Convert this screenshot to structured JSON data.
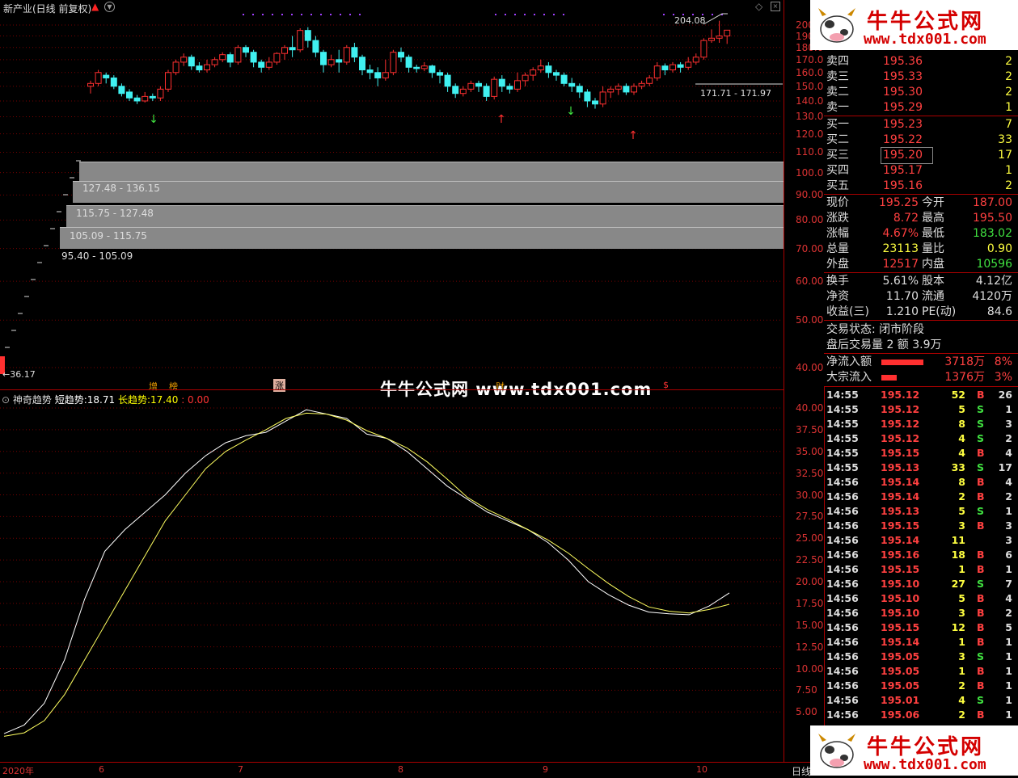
{
  "main_title": "新产业(日线 前复权)",
  "indicator": {
    "name": "神奇趋势",
    "short_label": "短趋势:",
    "short_value": "18.71",
    "long_label": "长趋势:",
    "long_value": "17.40",
    "extra_value": ": 0.00"
  },
  "watermark": "牛牛公式网 www.tdx001.com",
  "logo": {
    "title": "牛牛公式网",
    "url": "www.tdx001.com"
  },
  "markers": {
    "zeng": "增",
    "bang": "榜",
    "zhang": "涨",
    "cai": "财",
    "dollar": "$"
  },
  "annotations": {
    "high": "204.08",
    "low": "36.17",
    "box": "171.71 - 171.97"
  },
  "price_bands": [
    {
      "label": "127.48 - 136.15"
    },
    {
      "label": "115.75 - 127.48"
    },
    {
      "label": "105.09 - 115.75"
    },
    {
      "label": "95.40 - 105.09"
    }
  ],
  "date_axis": {
    "year": "2020年",
    "months": [
      "6",
      "7",
      "8",
      "9",
      "10"
    ],
    "period": "日线"
  },
  "price_axis_labels": [
    "200",
    "190",
    "180.0",
    "170.0",
    "160.0",
    "150.0",
    "140.0",
    "130.0",
    "120.0",
    "110.0",
    "100.0",
    "90.00",
    "80.00",
    "70.00",
    "60.00",
    "50.00",
    "40.00"
  ],
  "ind_axis_labels": [
    "40.00",
    "37.50",
    "35.00",
    "32.50",
    "30.00",
    "27.50",
    "25.00",
    "22.50",
    "20.00",
    "17.50",
    "15.00",
    "12.50",
    "10.00",
    "7.50",
    "5.00"
  ],
  "order_book": {
    "asks": [
      {
        "label": "卖四",
        "price": "195.36",
        "vol": "2"
      },
      {
        "label": "卖三",
        "price": "195.33",
        "vol": "2"
      },
      {
        "label": "卖二",
        "price": "195.30",
        "vol": "2"
      },
      {
        "label": "卖一",
        "price": "195.29",
        "vol": "1"
      }
    ],
    "bids": [
      {
        "label": "买一",
        "price": "195.23",
        "vol": "7"
      },
      {
        "label": "买二",
        "price": "195.22",
        "vol": "33"
      },
      {
        "label": "买三",
        "price": "195.20",
        "vol": "17"
      },
      {
        "label": "买四",
        "price": "195.17",
        "vol": "1"
      },
      {
        "label": "买五",
        "price": "195.16",
        "vol": "2"
      }
    ]
  },
  "quote": [
    {
      "l1": "现价",
      "v1": "195.25",
      "l2": "今开",
      "v2": "187.00",
      "c1": "#ff4040",
      "c2": "#ff4040"
    },
    {
      "l1": "涨跌",
      "v1": "8.72",
      "l2": "最高",
      "v2": "195.50",
      "c1": "#ff4040",
      "c2": "#ff4040"
    },
    {
      "l1": "涨幅",
      "v1": "4.67%",
      "l2": "最低",
      "v2": "183.02",
      "c1": "#ff4040",
      "c2": "#40e040"
    },
    {
      "l1": "总量",
      "v1": "23113",
      "l2": "量比",
      "v2": "0.90",
      "c1": "#ffff40",
      "c2": "#ffff40"
    },
    {
      "l1": "外盘",
      "v1": "12517",
      "l2": "内盘",
      "v2": "10596",
      "c1": "#ff4040",
      "c2": "#40e040"
    }
  ],
  "fundamentals": [
    {
      "l1": "换手",
      "v1": "5.61%",
      "l2": "股本",
      "v2": "4.12亿"
    },
    {
      "l1": "净资",
      "v1": "11.70",
      "l2": "流通",
      "v2": "4120万"
    },
    {
      "l1": "收益(三)",
      "v1": "1.210",
      "l2": "PE(动)",
      "v2": "84.6"
    }
  ],
  "status": {
    "line1": "交易状态: 闭市阶段",
    "line2": "盘后交易量 2 额 3.9万"
  },
  "flows": [
    {
      "label": "净流入额",
      "value": "3718万",
      "pct": "8%",
      "bar": 0.95
    },
    {
      "label": "大宗流入",
      "value": "1376万",
      "pct": "3%",
      "bar": 0.35
    }
  ],
  "ticks": [
    {
      "t": "14:55",
      "p": "195.12",
      "v": "52",
      "s": "B",
      "n": "26"
    },
    {
      "t": "14:55",
      "p": "195.12",
      "v": "5",
      "s": "S",
      "n": "1"
    },
    {
      "t": "14:55",
      "p": "195.12",
      "v": "8",
      "s": "S",
      "n": "3"
    },
    {
      "t": "14:55",
      "p": "195.12",
      "v": "4",
      "s": "S",
      "n": "2"
    },
    {
      "t": "14:55",
      "p": "195.15",
      "v": "4",
      "s": "B",
      "n": "4"
    },
    {
      "t": "14:55",
      "p": "195.13",
      "v": "33",
      "s": "S",
      "n": "17"
    },
    {
      "t": "14:56",
      "p": "195.14",
      "v": "8",
      "s": "B",
      "n": "4"
    },
    {
      "t": "14:56",
      "p": "195.14",
      "v": "2",
      "s": "B",
      "n": "2"
    },
    {
      "t": "14:56",
      "p": "195.13",
      "v": "5",
      "s": "S",
      "n": "1"
    },
    {
      "t": "14:56",
      "p": "195.15",
      "v": "3",
      "s": "B",
      "n": "3"
    },
    {
      "t": "14:56",
      "p": "195.14",
      "v": "11",
      "s": "",
      "n": "3"
    },
    {
      "t": "14:56",
      "p": "195.16",
      "v": "18",
      "s": "B",
      "n": "6"
    },
    {
      "t": "14:56",
      "p": "195.15",
      "v": "1",
      "s": "B",
      "n": "1"
    },
    {
      "t": "14:56",
      "p": "195.10",
      "v": "27",
      "s": "S",
      "n": "7"
    },
    {
      "t": "14:56",
      "p": "195.10",
      "v": "5",
      "s": "B",
      "n": "4"
    },
    {
      "t": "14:56",
      "p": "195.10",
      "v": "3",
      "s": "B",
      "n": "2"
    },
    {
      "t": "14:56",
      "p": "195.15",
      "v": "12",
      "s": "B",
      "n": "5"
    },
    {
      "t": "14:56",
      "p": "195.14",
      "v": "1",
      "s": "B",
      "n": "1"
    },
    {
      "t": "14:56",
      "p": "195.05",
      "v": "3",
      "s": "S",
      "n": "1"
    },
    {
      "t": "14:56",
      "p": "195.05",
      "v": "1",
      "s": "B",
      "n": "1"
    },
    {
      "t": "14:56",
      "p": "195.05",
      "v": "2",
      "s": "B",
      "n": "1"
    },
    {
      "t": "14:56",
      "p": "195.01",
      "v": "4",
      "s": "S",
      "n": "1"
    },
    {
      "t": "14:56",
      "p": "195.06",
      "v": "2",
      "s": "B",
      "n": "1"
    }
  ],
  "chart_data": [
    {
      "type": "candlestick",
      "title": "新产业(日线 前复权)",
      "yscale": "log",
      "ylim": [
        36.17,
        204.08
      ],
      "candles": [
        [
          150,
          152,
          145,
          154
        ],
        [
          152,
          160,
          150,
          162
        ],
        [
          158,
          156,
          152,
          160
        ],
        [
          156,
          150,
          148,
          158
        ],
        [
          150,
          145,
          143,
          152
        ],
        [
          146,
          142,
          140,
          148
        ],
        [
          142,
          140,
          138,
          144
        ],
        [
          140,
          143,
          139,
          146
        ],
        [
          143,
          142,
          140,
          145
        ],
        [
          142,
          148,
          140,
          150
        ],
        [
          148,
          160,
          146,
          162
        ],
        [
          160,
          168,
          158,
          170
        ],
        [
          168,
          172,
          165,
          175
        ],
        [
          172,
          165,
          162,
          174
        ],
        [
          165,
          162,
          160,
          168
        ],
        [
          162,
          166,
          160,
          170
        ],
        [
          166,
          170,
          164,
          172
        ],
        [
          170,
          174,
          168,
          176
        ],
        [
          174,
          168,
          164,
          176
        ],
        [
          168,
          180,
          166,
          182
        ],
        [
          180,
          176,
          172,
          182
        ],
        [
          176,
          168,
          164,
          178
        ],
        [
          168,
          164,
          160,
          170
        ],
        [
          164,
          168,
          162,
          172
        ],
        [
          168,
          175,
          166,
          176
        ],
        [
          175,
          180,
          170,
          182
        ],
        [
          180,
          178,
          172,
          190
        ],
        [
          178,
          195,
          176,
          197
        ],
        [
          195,
          186,
          180,
          198
        ],
        [
          186,
          176,
          172,
          190
        ],
        [
          176,
          166,
          160,
          178
        ],
        [
          166,
          170,
          164,
          174
        ],
        [
          170,
          168,
          160,
          178
        ],
        [
          168,
          180,
          166,
          182
        ],
        [
          180,
          172,
          168,
          184
        ],
        [
          172,
          162,
          158,
          174
        ],
        [
          162,
          160,
          155,
          166
        ],
        [
          160,
          156,
          150,
          164
        ],
        [
          156,
          160,
          154,
          170
        ],
        [
          160,
          176,
          158,
          178
        ],
        [
          176,
          172,
          168,
          180
        ],
        [
          172,
          164,
          160,
          174
        ],
        [
          164,
          163,
          160,
          166
        ],
        [
          163,
          165,
          161,
          168
        ],
        [
          165,
          160,
          156,
          166
        ],
        [
          160,
          158,
          152,
          162
        ],
        [
          158,
          150,
          146,
          160
        ],
        [
          150,
          145,
          142,
          152
        ],
        [
          145,
          148,
          143,
          150
        ],
        [
          148,
          152,
          146,
          154
        ],
        [
          152,
          150,
          146,
          154
        ],
        [
          150,
          143,
          140,
          152
        ],
        [
          143,
          155,
          141,
          157
        ],
        [
          155,
          150,
          146,
          158
        ],
        [
          150,
          148,
          145,
          152
        ],
        [
          148,
          154,
          146,
          160
        ],
        [
          154,
          158,
          150,
          160
        ],
        [
          158,
          162,
          154,
          164
        ],
        [
          162,
          165,
          160,
          170
        ],
        [
          165,
          160,
          156,
          168
        ],
        [
          160,
          158,
          154,
          162
        ],
        [
          158,
          152,
          150,
          160
        ],
        [
          152,
          150,
          146,
          156
        ],
        [
          150,
          146,
          142,
          152
        ],
        [
          146,
          140,
          136,
          148
        ],
        [
          140,
          138,
          135,
          142
        ],
        [
          138,
          146,
          136,
          150
        ],
        [
          146,
          148,
          142,
          150
        ],
        [
          148,
          150,
          144,
          152
        ],
        [
          150,
          146,
          144,
          152
        ],
        [
          146,
          150,
          144,
          152
        ],
        [
          150,
          152,
          148,
          154
        ],
        [
          152,
          156,
          150,
          158
        ],
        [
          156,
          165,
          154,
          168
        ],
        [
          165,
          162,
          158,
          167
        ],
        [
          162,
          166,
          160,
          168
        ],
        [
          166,
          164,
          160,
          168
        ],
        [
          164,
          168,
          162,
          172
        ],
        [
          168,
          172,
          166,
          175
        ],
        [
          172,
          186,
          170,
          188
        ],
        [
          186,
          188,
          184,
          196
        ],
        [
          188,
          190,
          184,
          204.08
        ],
        [
          190,
          195.25,
          183.02,
          195.5
        ]
      ],
      "annotations": [
        "204.08",
        "36.17",
        "171.71 - 171.97"
      ],
      "price_bands": [
        "127.48 - 136.15",
        "115.75 - 127.48",
        "105.09 - 115.75",
        "95.40 - 105.09"
      ]
    },
    {
      "type": "line",
      "title": "神奇趋势",
      "ylim": [
        2,
        41
      ],
      "series": [
        {
          "name": "短趋势",
          "color": "#ffffff",
          "values": [
            2.5,
            3.5,
            6,
            11,
            18,
            23.5,
            26,
            28,
            30,
            32.5,
            34.5,
            36,
            36.8,
            37.2,
            38.5,
            39.8,
            39.3,
            38.8,
            37,
            36.5,
            35,
            33,
            31,
            29.5,
            28,
            27,
            26,
            24.5,
            22.5,
            20,
            18.5,
            17.3,
            16.5,
            16.3,
            16.2,
            17.2,
            18.71
          ]
        },
        {
          "name": "长趋势",
          "color": "#ffff60",
          "values": [
            2.2,
            2.6,
            4,
            7,
            11,
            15,
            19,
            23,
            27,
            30,
            33,
            35,
            36.3,
            37.5,
            38.8,
            39.4,
            39.3,
            38.6,
            37.4,
            36.5,
            35.4,
            33.8,
            31.8,
            29.7,
            28.3,
            27.2,
            26,
            24.8,
            23.3,
            21.5,
            19.8,
            18.3,
            17.1,
            16.6,
            16.4,
            16.8,
            17.4
          ]
        }
      ]
    }
  ]
}
